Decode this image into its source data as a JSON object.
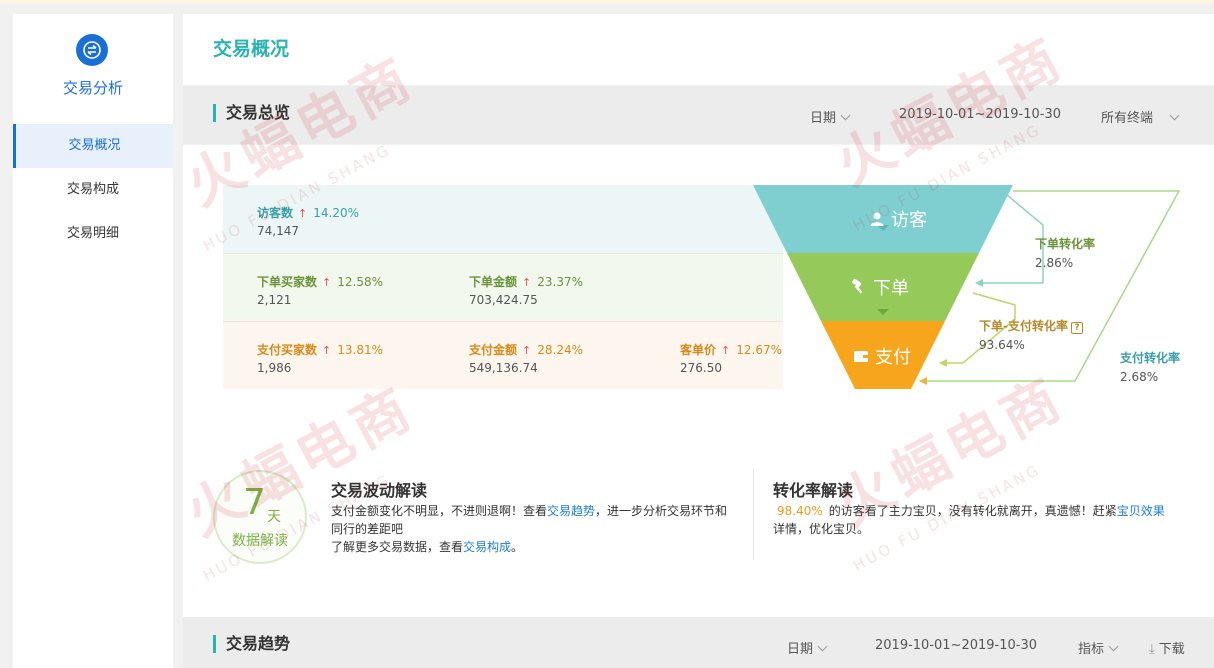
{
  "sidebar": {
    "title": "交易分析",
    "items": [
      {
        "label": "交易概况",
        "active": true
      },
      {
        "label": "交易构成",
        "active": false
      },
      {
        "label": "交易明细",
        "active": false
      }
    ]
  },
  "page": {
    "title": "交易概况"
  },
  "overview": {
    "title": "交易总览",
    "date_label": "日期",
    "date_range": "2019-10-01~2019-10-30",
    "terminal_label": "所有终端"
  },
  "metrics": {
    "visitors": {
      "label": "访客数",
      "change": "14.20%",
      "value": "74,147"
    },
    "order_buyers": {
      "label": "下单买家数",
      "change": "12.58%",
      "value": "2,121"
    },
    "order_amount": {
      "label": "下单金额",
      "change": "23.37%",
      "value": "703,424.75"
    },
    "pay_buyers": {
      "label": "支付买家数",
      "change": "13.81%",
      "value": "1,986"
    },
    "pay_amount": {
      "label": "支付金额",
      "change": "28.24%",
      "value": "549,136.74"
    },
    "unit_price": {
      "label": "客单价",
      "change": "12.67%",
      "value": "276.50"
    }
  },
  "funnel": {
    "stages": [
      "访客",
      "下单",
      "支付"
    ],
    "colors": [
      "#7fcfd0",
      "#95c95a",
      "#f7a51c"
    ],
    "rates": {
      "order_rate": {
        "label": "下单转化率",
        "value": "2.86%"
      },
      "order_pay_rate": {
        "label": "下单-支付转化率",
        "value": "93.64%"
      },
      "pay_rate": {
        "label": "支付转化率",
        "value": "2.68%"
      }
    }
  },
  "badge": {
    "number": "7",
    "unit": "天",
    "caption": "数据解读"
  },
  "fluctuation": {
    "title": "交易波动解读",
    "line1_a": "支付金额变化不明显，不进则退啊！查看",
    "line1_link": "交易趋势",
    "line1_b": "，进一步分析交易环节和",
    "line2": "同行的差距吧",
    "line3_a": "了解更多交易数据，查看",
    "line3_link": "交易构成",
    "line3_b": "。"
  },
  "conversion": {
    "title": "转化率解读",
    "pct": "98.40%",
    "line1_a": "的访客看了主力宝贝，没有转化就离开，真遗憾！赶紧",
    "line1_link": "宝贝效果",
    "line2": "详情，优化宝贝。"
  },
  "trend": {
    "title": "交易趋势",
    "date_label": "日期",
    "date_range": "2019-10-01~2019-10-30",
    "indicator_label": "指标",
    "download_label": "下载"
  },
  "watermark": {
    "text": "火蝠电商",
    "sub": "HUO FU DIAN SHANG"
  }
}
